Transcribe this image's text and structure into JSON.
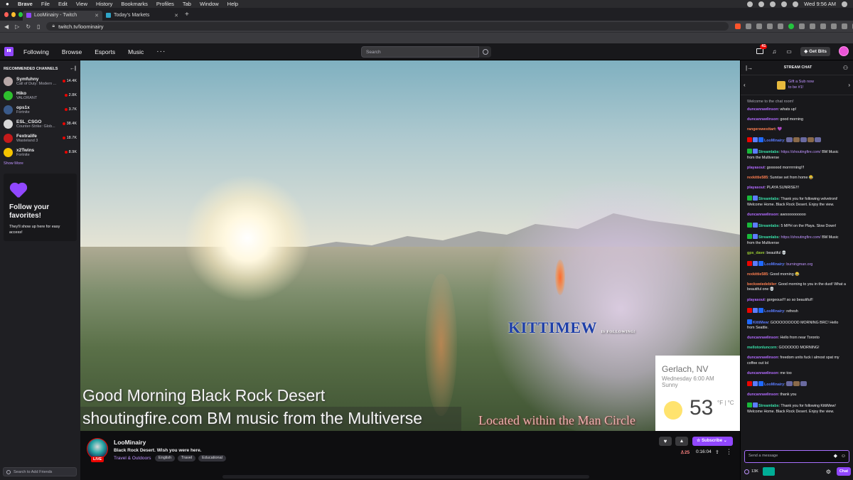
{
  "mac_menu": {
    "items": [
      "Brave",
      "File",
      "Edit",
      "View",
      "History",
      "Bookmarks",
      "Profiles",
      "Tab",
      "Window",
      "Help"
    ],
    "clock": "Wed 9:56 AM"
  },
  "tabs": [
    {
      "label": "LooMinairy - Twitch"
    },
    {
      "label": "Today's Markets"
    }
  ],
  "address": {
    "url": "twitch.tv/loominairy",
    "brave_count": "43",
    "ext_badge": "6"
  },
  "topnav": {
    "links": [
      "Following",
      "Browse",
      "Esports",
      "Music"
    ],
    "more": "···",
    "search_placeholder": "Search",
    "notif_count": "41",
    "get_bits": "Get Bits"
  },
  "sidebar": {
    "header": "RECOMMENDED CHANNELS",
    "channels": [
      {
        "name": "Symfuhny",
        "game": "Call of Duty: Modern ...",
        "viewers": "14.4K",
        "color": "#b8a8a8"
      },
      {
        "name": "Hiko",
        "game": "VALORANT",
        "viewers": "2.8K",
        "color": "#2ec02e"
      },
      {
        "name": "ops1x",
        "game": "Fortnite",
        "viewers": "3.7K",
        "color": "#3a5a8a"
      },
      {
        "name": "ESL_CSGO",
        "game": "Counter-Strike: Glob...",
        "viewers": "38.4K",
        "color": "#d8d8d8"
      },
      {
        "name": "Fextralife",
        "game": "Wasteland 3",
        "viewers": "18.7K",
        "color": "#c41a1a"
      },
      {
        "name": "x2Twins",
        "game": "Fortnite",
        "viewers": "8.9K",
        "color": "#f5c400"
      }
    ],
    "show_more": "Show More",
    "follow_card": {
      "title": "Follow your favorites!",
      "body": "They'll show up here for easy access!"
    },
    "add_friends_placeholder": "Search to Add Friends"
  },
  "video": {
    "alert_user": "KITTIMEW",
    "alert_msg": "IS FOLLOWING!",
    "overlay_line1": "Good Morning Black Rock Desert",
    "overlay_line2": "shoutingfire.com BM music from the Multiverse",
    "overlay_line3": "Located within the Man Circle",
    "weather": {
      "city": "Gerlach, NV",
      "day": "Wednesday 6:00 AM",
      "condition": "Sunny",
      "temp": "53",
      "unit": "°F | °C"
    }
  },
  "stream_info": {
    "streamer": "LooMinairy",
    "live": "LIVE",
    "title": "Black Rock Desert. Wish you were here.",
    "category": "Travel & Outdoors",
    "tags": [
      "English",
      "Travel",
      "Educational"
    ],
    "subscribe": "Subscribe",
    "viewers": "25",
    "uptime": "0:16:04"
  },
  "chat": {
    "header": "STREAM CHAT",
    "gift_text": "Gift a Sub now to be #1!",
    "welcome": "Welcome to the chat room!",
    "messages": [
      {
        "user": "duncanrawlinson",
        "color": "#b36bff",
        "text": "whats up!"
      },
      {
        "user": "duncanrawlinson",
        "color": "#b36bff",
        "text": "good morning"
      },
      {
        "user": "rangerswesttart",
        "color": "#ff7f50",
        "text": "💜"
      },
      {
        "user": "LooMinairy",
        "color": "#5b7cff",
        "text": "",
        "badges": 3,
        "emotes": 5
      },
      {
        "user": "Streamlabs",
        "color": "#39e0a9",
        "text": "",
        "link": "https://shoutingfire.com/",
        "after": " BM Music from the Multiverse",
        "badges": 2
      },
      {
        "user": "playasout",
        "color": "#b36bff",
        "text": "goooood morrrrrning!!!"
      },
      {
        "user": "rexkittie585",
        "color": "#ff7f50",
        "text": "Sunrise set from home 😂"
      },
      {
        "user": "playasout",
        "color": "#b36bff",
        "text": "PLAYA SUNRISE!!!"
      },
      {
        "user": "Streamlabs",
        "color": "#39e0a9",
        "text": "Thank you for following velvetroni! Welcome Home. Black Rock Desert. Enjoy the view.",
        "badges": 2
      },
      {
        "user": "duncanrawlinson",
        "color": "#b36bff",
        "text": "awoooooooooo"
      },
      {
        "user": "Streamlabs",
        "color": "#39e0a9",
        "text": "5 MPH on the Playa. Slow Down!",
        "badges": 2
      },
      {
        "user": "Streamlabs",
        "color": "#39e0a9",
        "text": "",
        "link": "https://shoutingfire.com/",
        "after": " BM Music from the Multiverse",
        "badges": 2
      },
      {
        "user": "gps_dave",
        "color": "#9acd32",
        "text": "beautiful 💀"
      },
      {
        "user": "LooMinairy",
        "color": "#5b7cff",
        "text": "",
        "link": "burningman.org",
        "badges": 3
      },
      {
        "user": "rexkittie585",
        "color": "#ff7f50",
        "text": "Good morning 😂"
      },
      {
        "user": "beckswiedebiler",
        "color": "#ff7f50",
        "text": "Good morning to you in the dust! What a beautiful one 💀"
      },
      {
        "user": "playasout",
        "color": "#b36bff",
        "text": "gorgeous!!! so so beautiful!!"
      },
      {
        "user": "LooMinairy",
        "color": "#5b7cff",
        "text": "refresh",
        "badges": 3
      },
      {
        "user": "KittiMew",
        "color": "#5b7cff",
        "text": "GOOOOOOOOD MORNING BRC! Hello from Seattle.",
        "badges": 1
      },
      {
        "user": "duncanrawlinson",
        "color": "#b36bff",
        "text": "Hello from near Toronto"
      },
      {
        "user": "mellotonluncorn",
        "color": "#39e0a9",
        "text": "GOOOOOD MORNING!"
      },
      {
        "user": "duncanrawlinson",
        "color": "#b36bff",
        "text": "freedom units fuck i almost spat my coffee out lol"
      },
      {
        "user": "duncanrawlinson",
        "color": "#b36bff",
        "text": "me too"
      },
      {
        "user": "LooMinairy",
        "color": "#5b7cff",
        "text": "",
        "badges": 3,
        "emotes": 3
      },
      {
        "user": "duncanrawlinson",
        "color": "#b36bff",
        "text": "thank you"
      },
      {
        "user": "Streamlabs",
        "color": "#39e0a9",
        "text": "Thank you for following KittiMew! Welcome Home. Black Rock Desert. Enjoy the view.",
        "badges": 2
      }
    ],
    "input_placeholder": "Send a message",
    "points": "13K",
    "chat_button": "Chat"
  },
  "colors": {
    "twitch_purple": "#9147ff",
    "live_red": "#eb0400"
  }
}
